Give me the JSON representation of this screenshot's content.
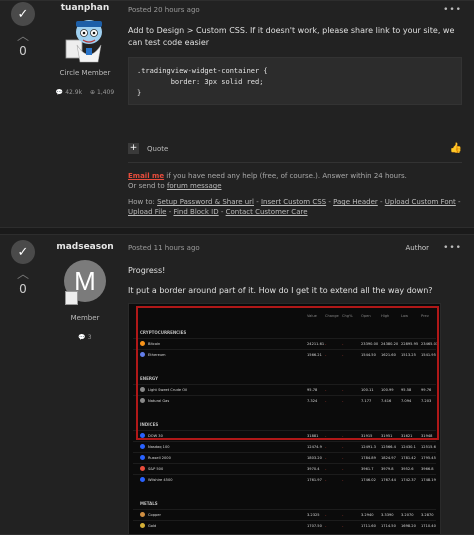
{
  "post1": {
    "vote_count": "0",
    "author_name": "tuanphan",
    "author_rank": "Circle Member",
    "stat_posts": "42.9k",
    "stat_rep": "1,409",
    "timestamp": "Posted 20 hours ago",
    "body": "Add to Design > Custom CSS. If it doesn't work, please share link to your site, we can test code easier",
    "code": ".tradingview-widget-container {\n        border: 3px solid red;\n}",
    "quote_label": "Quote",
    "sig_email": "Email me",
    "sig_text1": " if you have need any help (free, of course.). Answer within 24 hours.",
    "sig_text2": "Or send to ",
    "sig_forum": "forum message",
    "sig_howto": "How to: ",
    "sig_links": [
      "Setup Password & Share url",
      "Insert Custom CSS",
      "Page Header",
      "Upload Custom Font",
      "Upload File",
      "Find Block ID",
      "Contact Customer Care"
    ]
  },
  "post2": {
    "vote_count": "0",
    "author_name": "madseason",
    "avatar_letter": "M",
    "author_rank": "Member",
    "stat_posts": "3",
    "timestamp": "Posted 11 hours ago",
    "role": "Author",
    "line1": "Progress!",
    "line2": "It put a border around part of it. How do I get it to extend all the way down?"
  },
  "widget": {
    "columns": [
      "Value",
      "Change",
      "Chg%",
      "Open",
      "High",
      "Low",
      "Prev"
    ],
    "sections": [
      {
        "title": "CRYPTOCURRENCIES",
        "rows": [
          {
            "name": "Bitcoin",
            "icon": "#f7931a",
            "v": [
              "24211.61",
              "-",
              "-",
              "23390.00",
              "24380.20",
              "22895.95",
              "23465.01"
            ]
          },
          {
            "name": "Ethereum",
            "icon": "#627eea",
            "v": [
              "1566.21",
              "-",
              "-",
              "1544.50",
              "1621.60",
              "1513.25",
              "1541.95"
            ]
          }
        ]
      },
      {
        "title": "ENERGY",
        "rows": [
          {
            "name": "Light Sweet Crude Oil",
            "icon": "#888888",
            "v": [
              "95.78",
              "-",
              "-",
              "100.11",
              "100.99",
              "95.58",
              "99.76"
            ]
          },
          {
            "name": "Natural Gas",
            "icon": "#888888",
            "v": [
              "7.324",
              "-",
              "-",
              "7.177",
              "7.416",
              "7.094",
              "7.203"
            ]
          }
        ]
      },
      {
        "title": "INDICES",
        "rows": [
          {
            "name": "DOW 30",
            "icon": "#2962ff",
            "v": [
              "31881",
              "-",
              "-",
              "31915",
              "31951",
              "31621",
              "31948"
            ]
          },
          {
            "name": "Nasdaq 100",
            "icon": "#2962ff",
            "v": [
              "12474.9",
              "-",
              "-",
              "12491.3",
              "12566.4",
              "12430.1",
              "12515.6"
            ]
          },
          {
            "name": "Russell 2000",
            "icon": "#2962ff",
            "v": [
              "1803.20",
              "-",
              "-",
              "1784.89",
              "1824.97",
              "1781.42",
              "1795.45"
            ]
          },
          {
            "name": "S&P 500",
            "icon": "#e74c3c",
            "v": [
              "3970.4",
              "-",
              "-",
              "3961.7",
              "3979.8",
              "3952.6",
              "3966.8"
            ]
          },
          {
            "name": "Wilshire 4500",
            "icon": "#2962ff",
            "v": [
              "1761.97",
              "-",
              "-",
              "1746.02",
              "1767.44",
              "1742.37",
              "1748.19"
            ]
          }
        ]
      },
      {
        "title": "METALS",
        "rows": [
          {
            "name": "Copper",
            "icon": "#d08f42",
            "v": [
              "3.2325",
              "-",
              "-",
              "3.2940",
              "3.3390",
              "3.2070",
              "3.2870"
            ]
          },
          {
            "name": "Gold",
            "icon": "#d4af37",
            "v": [
              "1707.50",
              "-",
              "-",
              "1711.60",
              "1714.50",
              "1698.20",
              "1710.40"
            ]
          }
        ]
      }
    ]
  }
}
